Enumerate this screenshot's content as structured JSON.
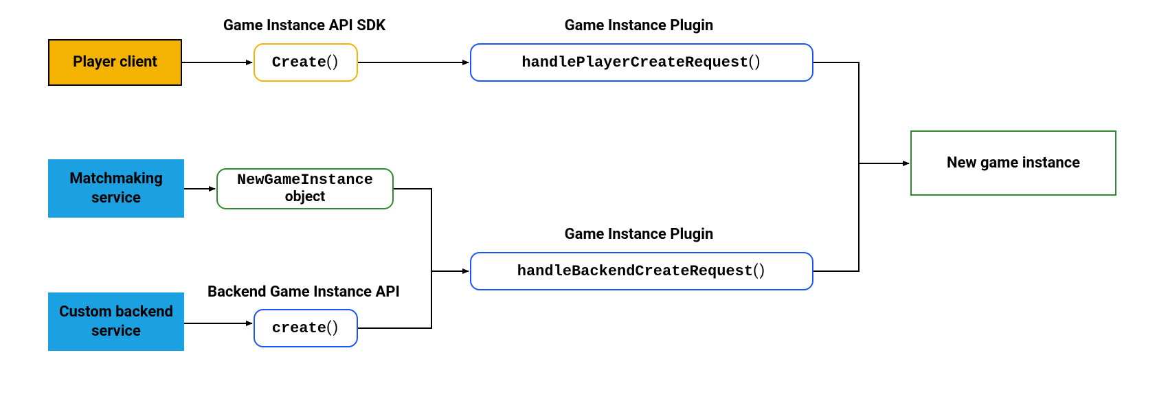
{
  "boxes": {
    "playerClient": "Player client",
    "matchmaking": "Matchmaking service",
    "customBackend": "Custom backend service",
    "create_sdk": "Create",
    "newGameInstance_l1": "NewGameInstance",
    "newGameInstance_l2": "object",
    "create_backend": "create",
    "handlePlayer": "handlePlayerCreateRequest",
    "handleBackend": "handleBackendCreateRequest",
    "newGameInstanceResult": "New game instance"
  },
  "labels": {
    "sdk": "Game Instance API SDK",
    "plugin_top": "Game Instance Plugin",
    "plugin_bottom": "Game Instance Plugin",
    "backendApi": "Backend Game Instance API"
  },
  "parens": "()"
}
